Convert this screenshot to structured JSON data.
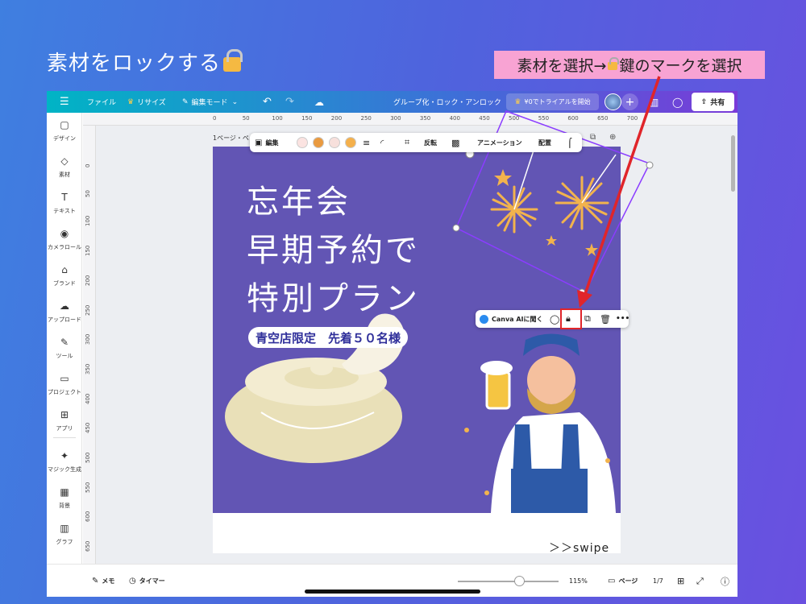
{
  "headline": "素材をロックする",
  "tooltip": {
    "before": "素材を選択→",
    "after": "鍵のマークを選択"
  },
  "topbar": {
    "menu_icon": "hamburger-icon",
    "file": "ファイル",
    "resize": "リサイズ",
    "edit_mode": "編集モード",
    "center_text": "グループ化・ロック・アンロック",
    "trial": "¥0でトライアルを開始",
    "share": "共有"
  },
  "sidebar": [
    {
      "label": "デザイン",
      "icon": "▢"
    },
    {
      "label": "素材",
      "icon": "◇"
    },
    {
      "label": "テキスト",
      "icon": "T"
    },
    {
      "label": "カメラロール",
      "icon": "◉"
    },
    {
      "label": "ブランド",
      "icon": "⌂"
    },
    {
      "label": "アップロード",
      "icon": "☁"
    },
    {
      "label": "ツール",
      "icon": "✎"
    },
    {
      "label": "プロジェクト",
      "icon": "▭"
    },
    {
      "label": "アプリ",
      "icon": "⊞"
    },
    {
      "label": "マジック生成",
      "icon": "✦"
    },
    {
      "label": "背景",
      "icon": "▦"
    },
    {
      "label": "グラフ",
      "icon": "▥"
    }
  ],
  "ruler": {
    "top": [
      "0",
      "50",
      "100",
      "150",
      "200",
      "250",
      "300",
      "350",
      "400",
      "450",
      "500",
      "550",
      "600",
      "650",
      "700"
    ],
    "left": [
      "0",
      "50",
      "100",
      "150",
      "200",
      "250",
      "300",
      "350",
      "400",
      "450",
      "500",
      "550",
      "600",
      "650"
    ]
  },
  "page_label": "1ページ・ペ",
  "element_toolbar": {
    "edit": "編集",
    "flip": "反転",
    "animation": "アニメーション",
    "arrange": "配置",
    "swatches": [
      "#fbe3e1",
      "#e99a40",
      "#f7e0dc",
      "#f4b04c"
    ]
  },
  "context_menu": {
    "ai": "Canva AIに聞く",
    "more": "•••"
  },
  "poster": {
    "title": [
      "忘年会",
      "早期予約で",
      "特別プラン"
    ],
    "badge": "青空店限定　先着５０名様",
    "swipe": "＞＞swipe"
  },
  "bottombar": {
    "memo": "メモ",
    "timer": "タイマー",
    "zoom": "115%",
    "page": "ページ",
    "page_count": "1/7"
  },
  "colors": {
    "poster_bg": "#6255b4",
    "highlight": "#e0252a",
    "tooltip_bg": "#f8a3d3"
  }
}
